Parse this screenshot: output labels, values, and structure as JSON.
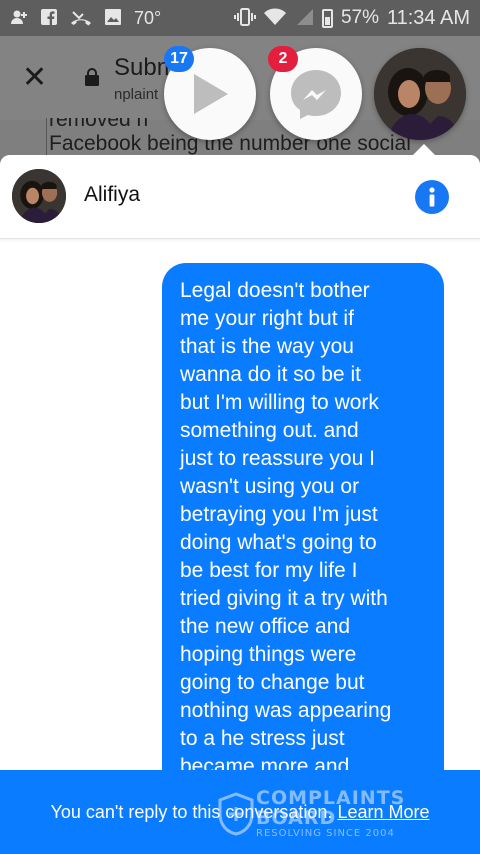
{
  "status_bar": {
    "temperature": "70°",
    "battery": "57%",
    "time": "11:34 AM"
  },
  "browser": {
    "title": "Subm",
    "url": "nplaint",
    "background_text": [
      "removed h",
      "Facebook being the number one social"
    ]
  },
  "chat_heads": [
    {
      "name": "video-head",
      "badge": "17"
    },
    {
      "name": "messenger-head",
      "badge": "2"
    }
  ],
  "conversation": {
    "name": "Alifiya",
    "message_lines": [
      "Legal doesn't bother",
      "me your right but if",
      "that is the way you",
      "wanna do it so be it",
      "but I'm willing to work",
      "something out. and",
      "just to reassure you I",
      "wasn't using you or",
      "betraying you I'm just",
      "doing what's going to",
      "be best for my life I",
      "tried giving it a try with",
      "the new office and",
      "hoping things were",
      "going to change but",
      "nothing was appearing",
      "to a   he stress just",
      "became more and"
    ]
  },
  "reply_bar": {
    "text": "You can't reply to this conversation.",
    "link": "Learn More"
  },
  "watermark": {
    "line1": "COMPLAINTS",
    "line2": "BOARD",
    "tagline": "RESOLVING SINCE 2004"
  },
  "colors": {
    "messenger_blue": "#0a7cff",
    "info_blue": "#1877f2",
    "badge_red": "#e41e3f"
  }
}
